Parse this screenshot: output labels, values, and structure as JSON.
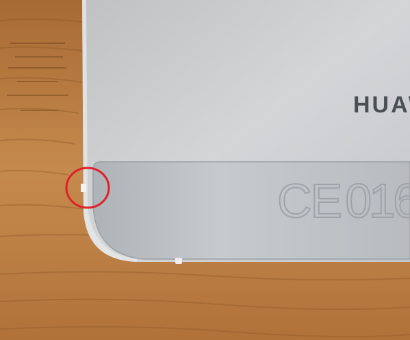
{
  "photo": {
    "brand_text": "HUAW",
    "ce_mark": "CE",
    "cert_number": "016",
    "annotation": "red-circle",
    "colors": {
      "wood": "#b87a3f",
      "metal": "#c9ccd0",
      "metal_band": "#b9bdc2",
      "annotation": "#e0202a"
    }
  }
}
